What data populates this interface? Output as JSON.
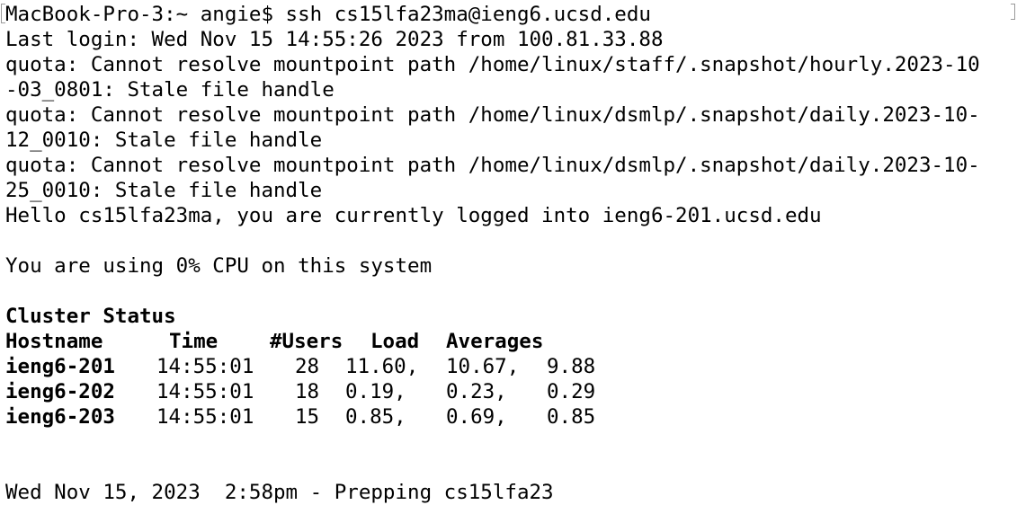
{
  "terminal": {
    "prompt_line": "MacBook-Pro-3:~ angie$ ssh cs15lfa23ma@ieng6.ucsd.edu",
    "last_login": "Last login: Wed Nov 15 14:55:26 2023 from 100.81.33.88",
    "quota_1a": "quota: Cannot resolve mountpoint path /home/linux/staff/.snapshot/hourly.2023-10",
    "quota_1b": "-03_0801: Stale file handle",
    "quota_2a": "quota: Cannot resolve mountpoint path /home/linux/dsmlp/.snapshot/daily.2023-10-",
    "quota_2b": "12_0010: Stale file handle",
    "quota_3a": "quota: Cannot resolve mountpoint path /home/linux/dsmlp/.snapshot/daily.2023-10-",
    "quota_3b": "25_0010: Stale file handle",
    "hello": "Hello cs15lfa23ma, you are currently logged into ieng6-201.ucsd.edu",
    "cpu": "You are using 0% CPU on this system",
    "cluster_title": "Cluster Status",
    "cluster_headers": [
      "Hostname",
      "Time",
      "#Users",
      "Load",
      "Averages"
    ],
    "cluster_rows": [
      {
        "host": "ieng6-201",
        "time": "14:55:01",
        "users": "28",
        "l1": "11.60,",
        "l2": "10.67,",
        "l3": "9.88"
      },
      {
        "host": "ieng6-202",
        "time": "14:55:01",
        "users": "18",
        "l1": "0.19,",
        "l2": "0.23,",
        "l3": "0.29"
      },
      {
        "host": "ieng6-203",
        "time": "14:55:01",
        "users": "15",
        "l1": "0.85,",
        "l2": "0.69,",
        "l3": "0.85"
      }
    ],
    "footer": "Wed Nov 15, 2023  2:58pm - Prepping cs15lfa23"
  }
}
